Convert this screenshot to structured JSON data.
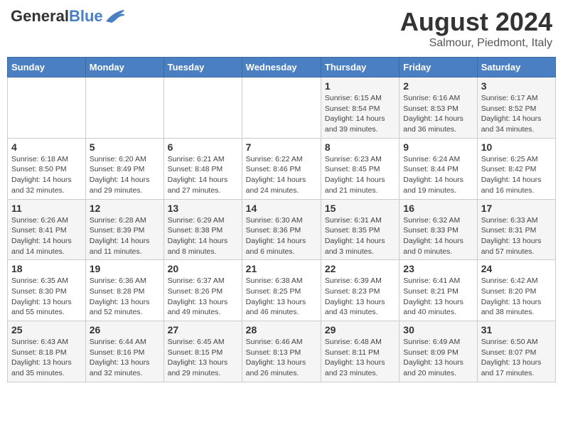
{
  "header": {
    "logo_general": "General",
    "logo_blue": "Blue",
    "month_title": "August 2024",
    "location": "Salmour, Piedmont, Italy"
  },
  "calendar": {
    "days_of_week": [
      "Sunday",
      "Monday",
      "Tuesday",
      "Wednesday",
      "Thursday",
      "Friday",
      "Saturday"
    ],
    "weeks": [
      [
        {
          "day": "",
          "info": ""
        },
        {
          "day": "",
          "info": ""
        },
        {
          "day": "",
          "info": ""
        },
        {
          "day": "",
          "info": ""
        },
        {
          "day": "1",
          "info": "Sunrise: 6:15 AM\nSunset: 8:54 PM\nDaylight: 14 hours and 39 minutes."
        },
        {
          "day": "2",
          "info": "Sunrise: 6:16 AM\nSunset: 8:53 PM\nDaylight: 14 hours and 36 minutes."
        },
        {
          "day": "3",
          "info": "Sunrise: 6:17 AM\nSunset: 8:52 PM\nDaylight: 14 hours and 34 minutes."
        }
      ],
      [
        {
          "day": "4",
          "info": "Sunrise: 6:18 AM\nSunset: 8:50 PM\nDaylight: 14 hours and 32 minutes."
        },
        {
          "day": "5",
          "info": "Sunrise: 6:20 AM\nSunset: 8:49 PM\nDaylight: 14 hours and 29 minutes."
        },
        {
          "day": "6",
          "info": "Sunrise: 6:21 AM\nSunset: 8:48 PM\nDaylight: 14 hours and 27 minutes."
        },
        {
          "day": "7",
          "info": "Sunrise: 6:22 AM\nSunset: 8:46 PM\nDaylight: 14 hours and 24 minutes."
        },
        {
          "day": "8",
          "info": "Sunrise: 6:23 AM\nSunset: 8:45 PM\nDaylight: 14 hours and 21 minutes."
        },
        {
          "day": "9",
          "info": "Sunrise: 6:24 AM\nSunset: 8:44 PM\nDaylight: 14 hours and 19 minutes."
        },
        {
          "day": "10",
          "info": "Sunrise: 6:25 AM\nSunset: 8:42 PM\nDaylight: 14 hours and 16 minutes."
        }
      ],
      [
        {
          "day": "11",
          "info": "Sunrise: 6:26 AM\nSunset: 8:41 PM\nDaylight: 14 hours and 14 minutes."
        },
        {
          "day": "12",
          "info": "Sunrise: 6:28 AM\nSunset: 8:39 PM\nDaylight: 14 hours and 11 minutes."
        },
        {
          "day": "13",
          "info": "Sunrise: 6:29 AM\nSunset: 8:38 PM\nDaylight: 14 hours and 8 minutes."
        },
        {
          "day": "14",
          "info": "Sunrise: 6:30 AM\nSunset: 8:36 PM\nDaylight: 14 hours and 6 minutes."
        },
        {
          "day": "15",
          "info": "Sunrise: 6:31 AM\nSunset: 8:35 PM\nDaylight: 14 hours and 3 minutes."
        },
        {
          "day": "16",
          "info": "Sunrise: 6:32 AM\nSunset: 8:33 PM\nDaylight: 14 hours and 0 minutes."
        },
        {
          "day": "17",
          "info": "Sunrise: 6:33 AM\nSunset: 8:31 PM\nDaylight: 13 hours and 57 minutes."
        }
      ],
      [
        {
          "day": "18",
          "info": "Sunrise: 6:35 AM\nSunset: 8:30 PM\nDaylight: 13 hours and 55 minutes."
        },
        {
          "day": "19",
          "info": "Sunrise: 6:36 AM\nSunset: 8:28 PM\nDaylight: 13 hours and 52 minutes."
        },
        {
          "day": "20",
          "info": "Sunrise: 6:37 AM\nSunset: 8:26 PM\nDaylight: 13 hours and 49 minutes."
        },
        {
          "day": "21",
          "info": "Sunrise: 6:38 AM\nSunset: 8:25 PM\nDaylight: 13 hours and 46 minutes."
        },
        {
          "day": "22",
          "info": "Sunrise: 6:39 AM\nSunset: 8:23 PM\nDaylight: 13 hours and 43 minutes."
        },
        {
          "day": "23",
          "info": "Sunrise: 6:41 AM\nSunset: 8:21 PM\nDaylight: 13 hours and 40 minutes."
        },
        {
          "day": "24",
          "info": "Sunrise: 6:42 AM\nSunset: 8:20 PM\nDaylight: 13 hours and 38 minutes."
        }
      ],
      [
        {
          "day": "25",
          "info": "Sunrise: 6:43 AM\nSunset: 8:18 PM\nDaylight: 13 hours and 35 minutes."
        },
        {
          "day": "26",
          "info": "Sunrise: 6:44 AM\nSunset: 8:16 PM\nDaylight: 13 hours and 32 minutes."
        },
        {
          "day": "27",
          "info": "Sunrise: 6:45 AM\nSunset: 8:15 PM\nDaylight: 13 hours and 29 minutes."
        },
        {
          "day": "28",
          "info": "Sunrise: 6:46 AM\nSunset: 8:13 PM\nDaylight: 13 hours and 26 minutes."
        },
        {
          "day": "29",
          "info": "Sunrise: 6:48 AM\nSunset: 8:11 PM\nDaylight: 13 hours and 23 minutes."
        },
        {
          "day": "30",
          "info": "Sunrise: 6:49 AM\nSunset: 8:09 PM\nDaylight: 13 hours and 20 minutes."
        },
        {
          "day": "31",
          "info": "Sunrise: 6:50 AM\nSunset: 8:07 PM\nDaylight: 13 hours and 17 minutes."
        }
      ]
    ]
  }
}
